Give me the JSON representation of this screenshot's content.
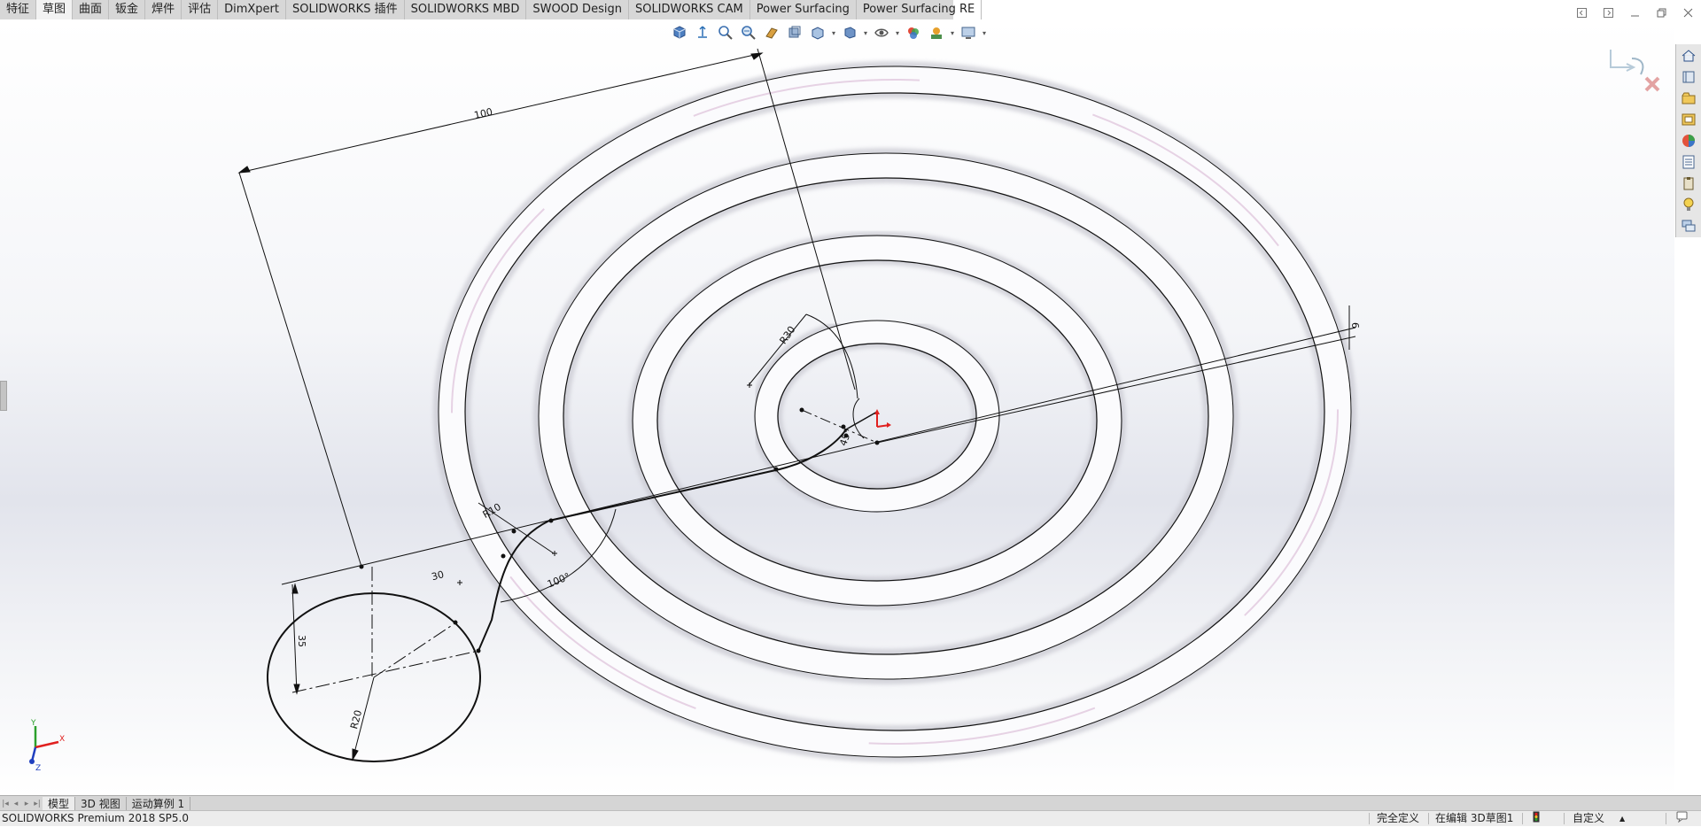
{
  "app": {
    "status_product": "SOLIDWORKS Premium 2018 SP5.0"
  },
  "tabs": [
    {
      "label": "特征",
      "active": false
    },
    {
      "label": "草图",
      "active": true
    },
    {
      "label": "曲面",
      "active": false
    },
    {
      "label": "钣金",
      "active": false
    },
    {
      "label": "焊件",
      "active": false
    },
    {
      "label": "评估",
      "active": false
    },
    {
      "label": "DimXpert",
      "active": false
    },
    {
      "label": "SOLIDWORKS 插件",
      "active": false
    },
    {
      "label": "SOLIDWORKS MBD",
      "active": false
    },
    {
      "label": "SWOOD Design",
      "active": false
    },
    {
      "label": "SOLIDWORKS CAM",
      "active": false
    },
    {
      "label": "Power Surfacing",
      "active": false
    },
    {
      "label": "Power Surfacing RE",
      "active": false
    }
  ],
  "hud_icons": [
    "view-cube-icon",
    "fit-icon",
    "zoom-area-icon",
    "zoom-previous-icon",
    "section-view-icon",
    "dynamic-annotation-icon",
    "view-orientation-icon",
    "display-style-icon",
    "hide-show-icon",
    "edit-appearance-icon",
    "apply-scene-icon",
    "view-settings-icon"
  ],
  "taskpane_icons": [
    "home-icon",
    "resources-icon",
    "design-library-icon",
    "file-explorer-icon",
    "appearances-icon",
    "custom-properties-icon",
    "clipboard-icon",
    "tips-icon",
    "forum-icon"
  ],
  "dimensions": {
    "d100_top": "100",
    "d6": "6",
    "dR30": "R30",
    "d45deg": "45°",
    "dR10": "R10",
    "d100deg": "100°",
    "d30": "30",
    "d35": "35",
    "dR20": "R20"
  },
  "triad": {
    "x": "X",
    "y": "Y",
    "z": "Z"
  },
  "bottom_tabs": [
    {
      "label": "模型",
      "active": true
    },
    {
      "label": "3D 视图",
      "active": false
    },
    {
      "label": "运动算例 1",
      "active": false
    }
  ],
  "status": {
    "definition": "完全定义",
    "editing": "在编辑 3D草图1",
    "units": "自定义",
    "units_arrow": "▲"
  },
  "colors": {
    "tab_bg": "#d7d7d7",
    "active_tab_bg": "#f2f2f2",
    "sketch_line": "#111111",
    "origin_red": "#e0201f"
  }
}
